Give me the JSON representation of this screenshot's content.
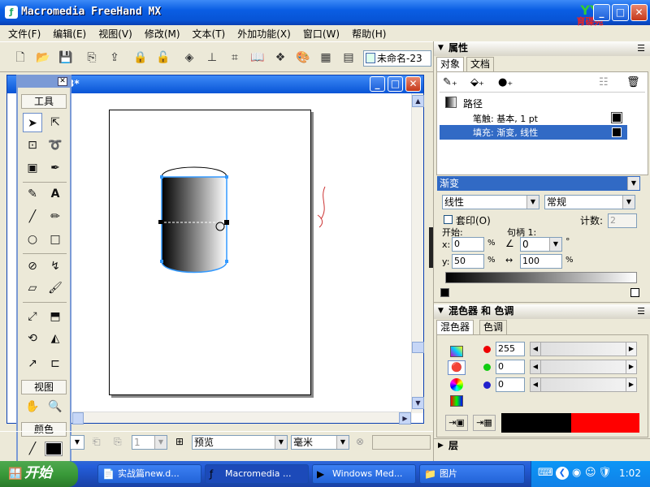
{
  "app": {
    "title": "Macromedia FreeHand MX",
    "icon": "freehand-app-icon",
    "window_buttons": [
      "minimize",
      "maximize",
      "close"
    ]
  },
  "watermark_logo": "YY 育碟苑",
  "menubar": [
    "文件(F)",
    "编辑(E)",
    "视图(V)",
    "修改(M)",
    "文本(T)",
    "外加功能(X)",
    "窗口(W)",
    "帮助(H)"
  ],
  "toolbar": {
    "icons": [
      "new-icon",
      "open-icon",
      "save-icon",
      "import-icon",
      "export-icon",
      "lock-icon",
      "unlock-icon",
      "group-icon",
      "align-icon",
      "transform-icon",
      "book-icon",
      "symbols-icon",
      "color-palette-icon",
      "table-icon",
      "layers-icon"
    ],
    "document_tab": "未命名-23"
  },
  "document": {
    "title_suffix": "3*"
  },
  "tools_panel": {
    "header": "工具",
    "view_header": "视图",
    "color_header": "颜色"
  },
  "statusbar": {
    "page_number": "1",
    "view_mode": "预览",
    "units": "毫米"
  },
  "properties": {
    "header": "属性",
    "tabs": [
      "对象",
      "文档"
    ],
    "object_tree": {
      "root": "路径",
      "stroke": "笔触: 基本, 1 pt",
      "fill": "填充: 渐变, 线性"
    },
    "fill_type": "渐变",
    "gradient_kind": "线性",
    "blend_mode": "常规",
    "overprint_label": "套印(O)",
    "count_label": "计数:",
    "count_value": "2",
    "start_label": "开始:",
    "handle_label": "句柄 1:",
    "x_label": "x:",
    "x_value": "0",
    "y_label": "y:",
    "y_value": "50",
    "percent": "%",
    "angle_value": "0",
    "degree": "°",
    "width_value": "100"
  },
  "mixer": {
    "header": "混色器 和 色调",
    "tabs": [
      "混色器",
      "色调"
    ],
    "r_value": "255",
    "g_value": "0",
    "b_value": "0",
    "swatch_left": "#000000",
    "swatch_right": "#ff0000"
  },
  "layers_header": "层",
  "taskbar": {
    "start_label": "开始",
    "tasks": [
      "实战篇new.d...",
      "Macromedia ...",
      "Windows Med...",
      "图片"
    ],
    "clock": "1:02"
  },
  "colors": {
    "xp_blue": "#0a5ee3",
    "selection": "#316ac5",
    "path_blue": "#3399ff"
  }
}
